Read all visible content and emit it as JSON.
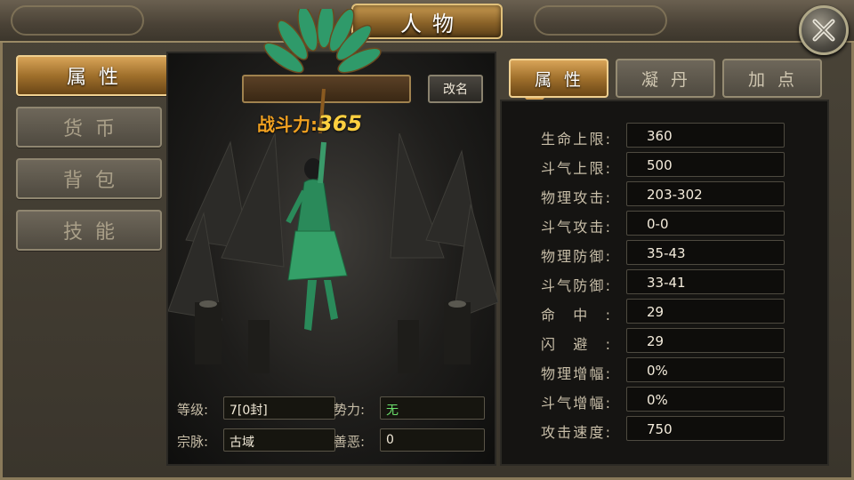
{
  "window": {
    "title": "人物",
    "close_icon": "close-x-icon"
  },
  "nav": {
    "items": [
      {
        "label": "属性",
        "active": true
      },
      {
        "label": "货币",
        "active": false
      },
      {
        "label": "背包",
        "active": false
      },
      {
        "label": "技能",
        "active": false
      }
    ]
  },
  "character": {
    "name": "",
    "rename_label": "改名",
    "power_label": "战斗力:",
    "power_value": "365",
    "info": {
      "level_label": "等级:",
      "level_value": "7[0封]",
      "faction_label": "势力:",
      "faction_value": "无",
      "lineage_label": "宗脉:",
      "lineage_value": "古域",
      "karma_label": "善恶:",
      "karma_value": "0"
    }
  },
  "tabs": [
    {
      "label": "属性",
      "active": true
    },
    {
      "label": "凝丹",
      "active": false
    },
    {
      "label": "加点",
      "active": false
    }
  ],
  "stats": [
    {
      "label": "生命上限:",
      "value": "360"
    },
    {
      "label": "斗气上限:",
      "value": "500"
    },
    {
      "label": "物理攻击:",
      "value": "203-302"
    },
    {
      "label": "斗气攻击:",
      "value": "0-0"
    },
    {
      "label": "物理防御:",
      "value": "35-43"
    },
    {
      "label": "斗气防御:",
      "value": "33-41"
    },
    {
      "label": "命中:",
      "value": "29"
    },
    {
      "label": "闪避:",
      "value": "29"
    },
    {
      "label": "物理增幅:",
      "value": "0%"
    },
    {
      "label": "斗气增幅:",
      "value": "0%"
    },
    {
      "label": "攻击速度:",
      "value": "750"
    }
  ],
  "colors": {
    "accent_gold": "#d8a458",
    "faction_green": "#6ce06c",
    "power_orange": "#f0a020"
  }
}
